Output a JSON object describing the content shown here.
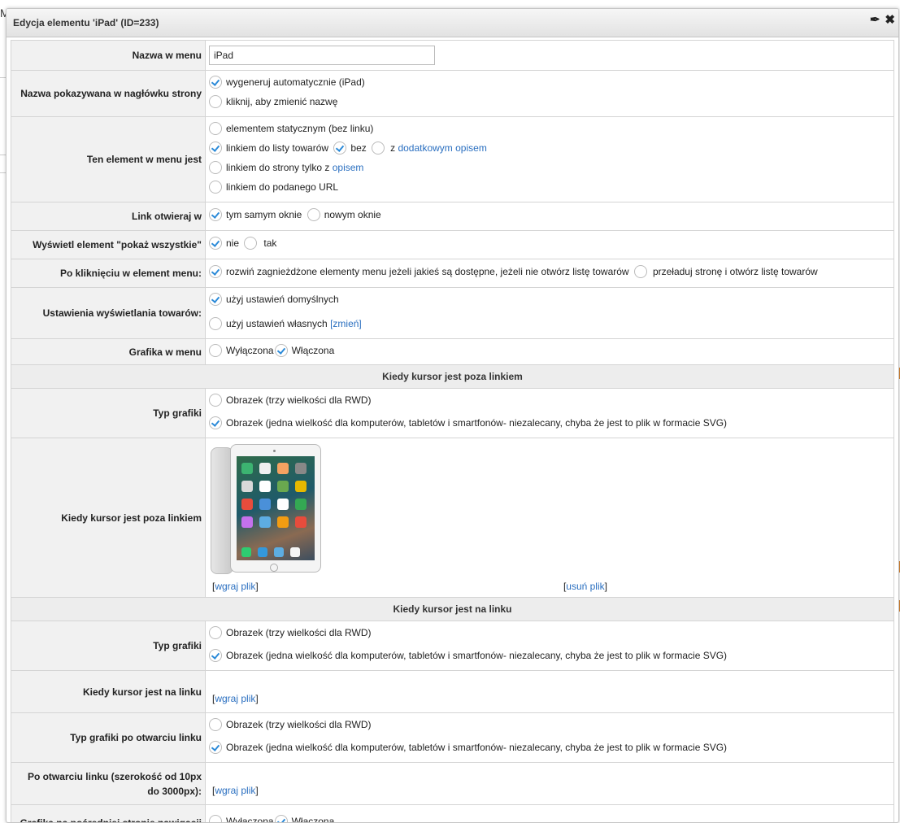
{
  "background": {
    "fragment": "M"
  },
  "dialog": {
    "title": "Edycja elementu 'iPad' (ID=233)",
    "pin_icon": "pin-icon",
    "close_icon": "close-icon"
  },
  "form": {
    "menu_name": {
      "label": "Nazwa w menu",
      "value": "iPad"
    },
    "header_name": {
      "label": "Nazwa pokazywana w nagłówku strony",
      "opt1": "wygeneruj automatycznie (iPad)",
      "opt2": "kliknij, aby zmienić nazwę"
    },
    "element_type": {
      "label": "Ten element w menu jest",
      "opt_static": "elementem statycznym (bez linku)",
      "opt_list": "linkiem do listy towarów",
      "opt_list_without": "bez",
      "opt_list_with": "z",
      "opt_list_with_link": "dodatkowym opisem",
      "opt_page": "linkiem do strony tylko z",
      "opt_page_link": "opisem",
      "opt_url": "linkiem do podanego URL"
    },
    "link_open": {
      "label": "Link otwieraj w",
      "opt1": "tym samym oknie",
      "opt2": "nowym oknie"
    },
    "show_all": {
      "label": "Wyświetl element \"pokaż wszystkie\"",
      "opt1": "nie",
      "opt2": "tak"
    },
    "on_click": {
      "label": "Po kliknięciu w element menu:",
      "opt1": "rozwiń zagnieżdżone elementy menu jeżeli jakieś są dostępne, jeżeli nie otwórz listę towarów",
      "opt2": "przeładuj stronę i otwórz listę towarów"
    },
    "display_settings": {
      "label": "Ustawienia wyświetlania towarów:",
      "opt1": "użyj ustawień domyślnych",
      "opt2": "użyj ustawień własnych",
      "opt2_link": "[zmień]"
    },
    "menu_graphic": {
      "label": "Grafika w menu",
      "opt1": "Wyłączona",
      "opt2": "Włączona"
    },
    "section_outside": "Kiedy kursor jest poza linkiem",
    "type_outside": {
      "label": "Typ grafiki",
      "opt1": "Obrazek (trzy wielkości dla RWD)",
      "opt2": "Obrazek (jedna wielkość dla komputerów, tabletów i smartfonów- niezalecany, chyba że jest to plik w formacie SVG)"
    },
    "image_outside": {
      "label": "Kiedy kursor jest poza linkiem",
      "upload": "wgraj plik",
      "remove": "usuń plik"
    },
    "section_on": "Kiedy kursor jest na linku",
    "type_on": {
      "label": "Typ grafiki",
      "opt1": "Obrazek (trzy wielkości dla RWD)",
      "opt2": "Obrazek (jedna wielkość dla komputerów, tabletów i smartfonów- niezalecany, chyba że jest to plik w formacie SVG)"
    },
    "image_on": {
      "label": "Kiedy kursor jest na linku",
      "upload": "wgraj plik"
    },
    "type_opened": {
      "label": "Typ grafiki po otwarciu linku",
      "opt1": "Obrazek (trzy wielkości dla RWD)",
      "opt2": "Obrazek (jedna wielkość dla komputerów, tabletów i smartfonów- niezalecany, chyba że jest to plik w formacie SVG)"
    },
    "image_opened": {
      "label": "Po otwarciu linku (szerokość od 10px do 3000px):",
      "upload": "wgraj plik"
    },
    "intermediate_graphic": {
      "label": "Grafika na pośredniej stronie nawigacji",
      "opt1": "Wyłączona",
      "opt2": "Włączona"
    }
  },
  "colors": {
    "accent": "#2b8ad8",
    "link": "#2a6fc0",
    "label_bg": "#f1f1f1"
  }
}
